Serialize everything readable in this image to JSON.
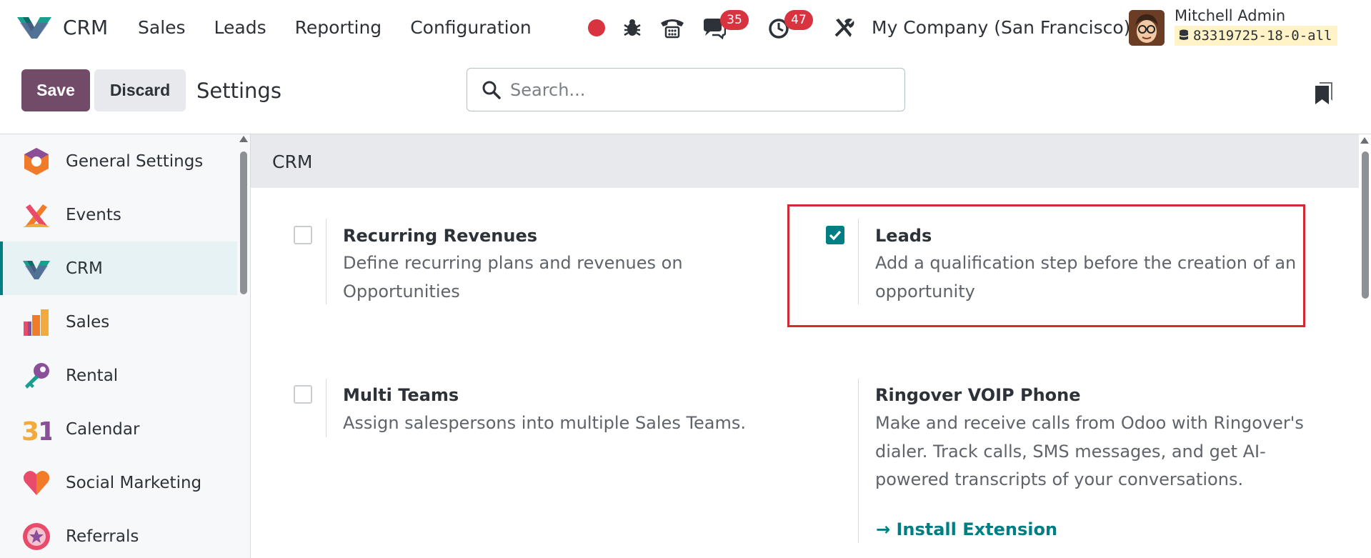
{
  "navbar": {
    "app_name": "CRM",
    "menu": [
      "Sales",
      "Leads",
      "Reporting",
      "Configuration"
    ],
    "messages_count": "35",
    "activities_count": "47",
    "company": "My Company (San Francisco)",
    "user_name": "Mitchell Admin",
    "database": "83319725-18-0-all"
  },
  "control_panel": {
    "save_label": "Save",
    "discard_label": "Discard",
    "title": "Settings",
    "search_placeholder": "Search..."
  },
  "sidebar": {
    "items": [
      {
        "label": "General Settings",
        "icon": "general-settings-icon"
      },
      {
        "label": "Events",
        "icon": "events-icon"
      },
      {
        "label": "CRM",
        "icon": "crm-icon",
        "active": true
      },
      {
        "label": "Sales",
        "icon": "sales-icon"
      },
      {
        "label": "Rental",
        "icon": "rental-icon"
      },
      {
        "label": "Calendar",
        "icon": "calendar-icon"
      },
      {
        "label": "Social Marketing",
        "icon": "social-marketing-icon"
      },
      {
        "label": "Referrals",
        "icon": "referrals-icon"
      }
    ]
  },
  "section": {
    "title": "CRM",
    "settings": [
      {
        "title": "Recurring Revenues",
        "desc": [
          "Define recurring plans and revenues on",
          "Opportunities"
        ],
        "checked": false
      },
      {
        "title": "Leads",
        "desc": [
          "Add a qualification step before the creation of an",
          "opportunity"
        ],
        "checked": true
      },
      {
        "title": "Multi Teams",
        "desc": [
          "Assign salespersons into multiple Sales Teams."
        ],
        "checked": false
      },
      {
        "title": "Ringover VOIP Phone",
        "desc": [
          "Make and receive calls from Odoo with Ringover's",
          "dialer. Track calls, SMS messages, and get AI-",
          "powered transcripts of your conversations."
        ],
        "link": "→ Install Extension"
      }
    ]
  },
  "colors": {
    "primary": "#714b67",
    "accent": "#017e84",
    "badge": "#d9333f",
    "highlight": "#d22a35"
  }
}
